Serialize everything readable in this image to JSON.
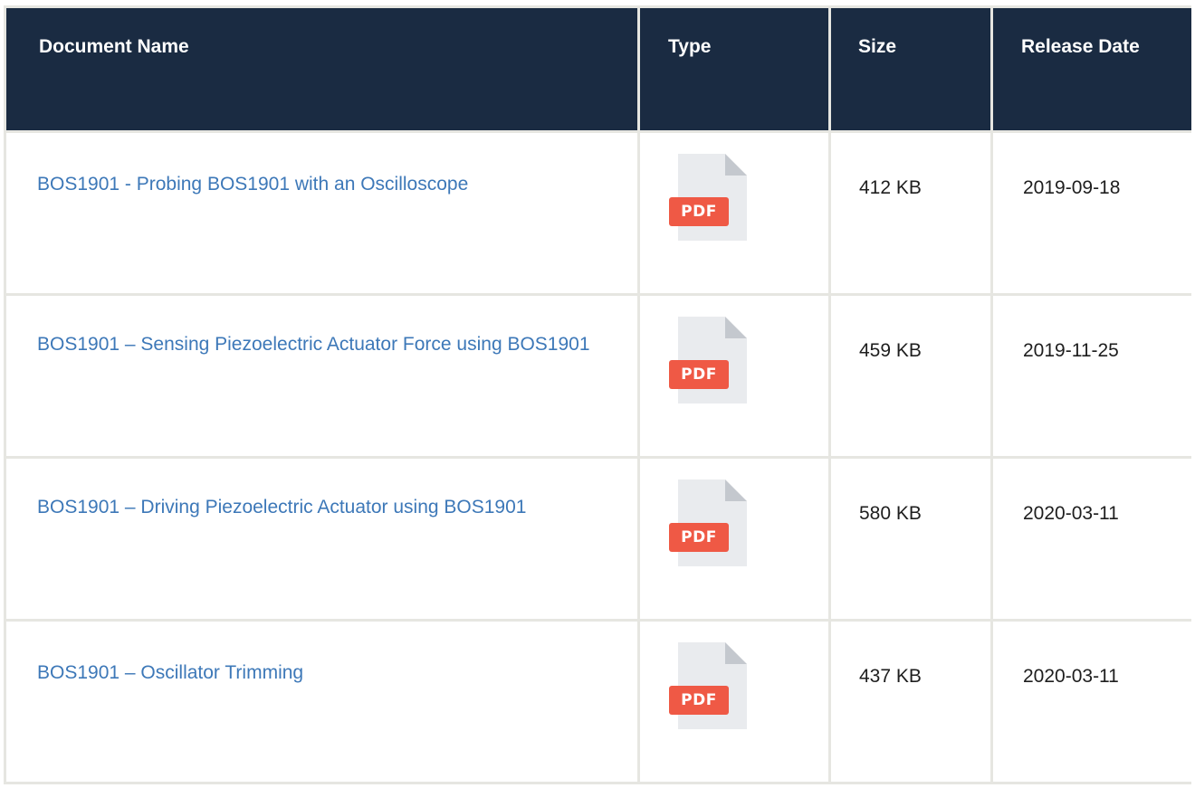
{
  "table": {
    "headers": {
      "name": "Document Name",
      "type": "Type",
      "size": "Size",
      "date": "Release Date"
    },
    "rows": [
      {
        "name": "BOS1901 - Probing BOS1901 with an Oscilloscope",
        "type": "PDF",
        "size": "412 KB",
        "date": "2019-09-18"
      },
      {
        "name": "BOS1901 – Sensing Piezoelectric Actuator Force using BOS1901",
        "type": "PDF",
        "size": "459 KB",
        "date": "2019-11-25"
      },
      {
        "name": "BOS1901 – Driving Piezoelectric Actuator using BOS1901",
        "type": "PDF",
        "size": "580 KB",
        "date": "2020-03-11"
      },
      {
        "name": "BOS1901 – Oscillator Trimming",
        "type": "PDF",
        "size": "437 KB",
        "date": "2020-03-11"
      }
    ]
  },
  "colors": {
    "header_bg": "#1a2b42",
    "link": "#3d78b8",
    "pdf_badge": "#ef5945",
    "border": "#e6e6e1"
  },
  "icons": {
    "file_type": "pdf-file-icon"
  }
}
